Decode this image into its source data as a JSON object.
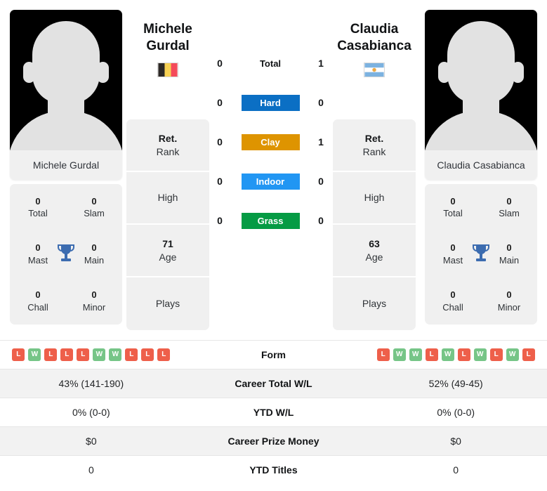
{
  "players": {
    "left": {
      "first_name": "Michele",
      "last_name": "Gurdal",
      "full_name": "Michele Gurdal",
      "flag": "belgium-flag",
      "rank_value": "Ret.",
      "rank_label": "Rank",
      "high_value": "",
      "high_label": "High",
      "age_value": "71",
      "age_label": "Age",
      "plays_value": "",
      "plays_label": "Plays",
      "titles": {
        "total_value": "0",
        "total_label": "Total",
        "slam_value": "0",
        "slam_label": "Slam",
        "mast_value": "0",
        "mast_label": "Mast",
        "main_value": "0",
        "main_label": "Main",
        "chall_value": "0",
        "chall_label": "Chall",
        "minor_value": "0",
        "minor_label": "Minor"
      },
      "form": [
        "L",
        "W",
        "L",
        "L",
        "L",
        "W",
        "W",
        "L",
        "L",
        "L"
      ],
      "career_total_wl": "43% (141-190)",
      "ytd_wl": "0% (0-0)",
      "career_prize_money": "$0",
      "ytd_titles": "0"
    },
    "right": {
      "first_name": "Claudia",
      "last_name": "Casabianca",
      "full_name": "Claudia Casabianca",
      "flag": "argentina-flag",
      "rank_value": "Ret.",
      "rank_label": "Rank",
      "high_value": "",
      "high_label": "High",
      "age_value": "63",
      "age_label": "Age",
      "plays_value": "",
      "plays_label": "Plays",
      "titles": {
        "total_value": "0",
        "total_label": "Total",
        "slam_value": "0",
        "slam_label": "Slam",
        "mast_value": "0",
        "mast_label": "Mast",
        "main_value": "0",
        "main_label": "Main",
        "chall_value": "0",
        "chall_label": "Chall",
        "minor_value": "0",
        "minor_label": "Minor"
      },
      "form": [
        "L",
        "W",
        "W",
        "L",
        "W",
        "L",
        "W",
        "L",
        "W",
        "L"
      ],
      "career_total_wl": "52% (49-45)",
      "ytd_wl": "0% (0-0)",
      "career_prize_money": "$0",
      "ytd_titles": "0"
    }
  },
  "surfaces": [
    {
      "label": "Total",
      "left": "0",
      "right": "1",
      "color": "transparent",
      "text_color": "#111315"
    },
    {
      "label": "Hard",
      "left": "0",
      "right": "0",
      "color": "#0b6fc4",
      "text_color": "#ffffff"
    },
    {
      "label": "Clay",
      "left": "0",
      "right": "1",
      "color": "#de9400",
      "text_color": "#ffffff"
    },
    {
      "label": "Indoor",
      "left": "0",
      "right": "0",
      "color": "#2196f3",
      "text_color": "#ffffff"
    },
    {
      "label": "Grass",
      "left": "0",
      "right": "0",
      "color": "#059b44",
      "text_color": "#ffffff"
    }
  ],
  "table_rows": [
    {
      "label": "Form",
      "key": "form",
      "type": "form"
    },
    {
      "label": "Career Total W/L",
      "key": "career_total_wl",
      "type": "text"
    },
    {
      "label": "YTD W/L",
      "key": "ytd_wl",
      "type": "text"
    },
    {
      "label": "Career Prize Money",
      "key": "career_prize_money",
      "type": "text"
    },
    {
      "label": "YTD Titles",
      "key": "ytd_titles",
      "type": "text"
    }
  ],
  "colors": {
    "win_badge": "#76c587",
    "loss_badge": "#ee5f4a",
    "card_bg": "#f0f0f0",
    "trophy": "#3c6cb0"
  }
}
